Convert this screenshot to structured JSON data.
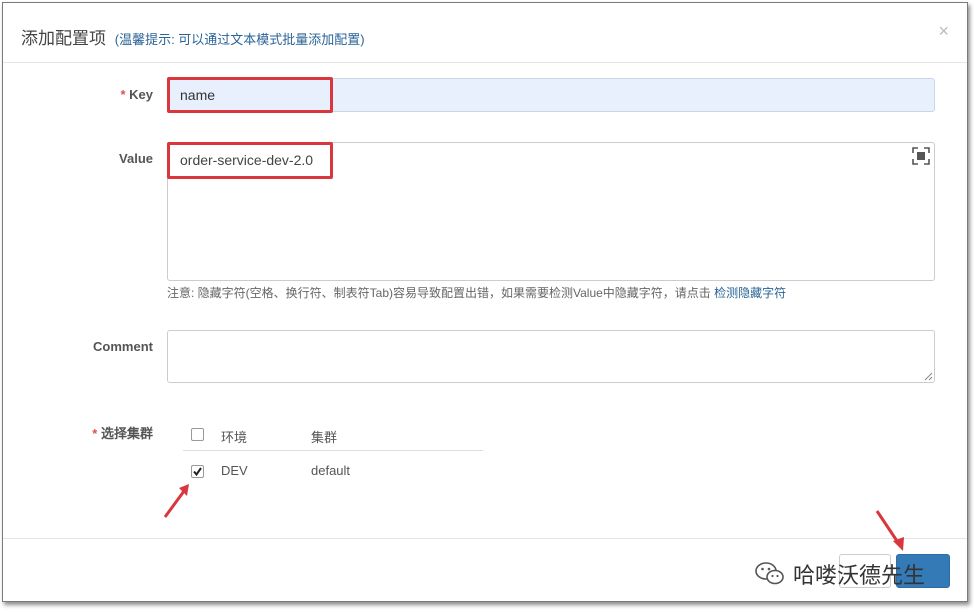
{
  "dialog": {
    "title": "添加配置项",
    "hint": "(温馨提示: 可以通过文本模式批量添加配置)",
    "close_symbol": "×"
  },
  "form": {
    "key_label": "Key",
    "key_value": "name",
    "value_label": "Value",
    "value_text": "order-service-dev-2.0",
    "note_text": "注意: 隐藏字符(空格、换行符、制表符Tab)容易导致配置出错，如果需要检测Value中隐藏字符，请点击",
    "note_link": "检测隐藏字符",
    "comment_label": "Comment",
    "comment_value": "",
    "cluster_label": "选择集群",
    "required_mark": "*"
  },
  "cluster_table": {
    "headers": [
      "环境",
      "集群"
    ],
    "header_checked": false,
    "rows": [
      {
        "env": "DEV",
        "cluster": "default",
        "checked": true
      }
    ]
  },
  "watermark": {
    "text": "哈喽沃德先生"
  },
  "colors": {
    "accent": "#337ab7",
    "highlight": "#d9363e",
    "key_input_bg": "#e8f0fe"
  },
  "icons": [
    "close-icon",
    "fullscreen-icon",
    "resize-handle-icon",
    "checkbox-icon",
    "arrow-annotation-icon",
    "wechat-icon"
  ]
}
